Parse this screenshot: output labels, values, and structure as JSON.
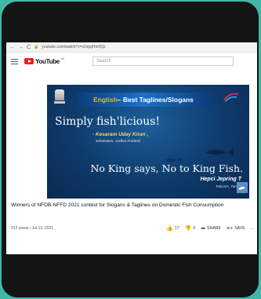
{
  "browser": {
    "back_glyph": "←",
    "forward_glyph": "→",
    "reload_glyph": "C",
    "url": "youtube.com/watch?v=x1xpqHofJQs"
  },
  "header": {
    "logo_text": "YouTube",
    "country": "IN",
    "search_placeholder": "Search"
  },
  "video": {
    "banner_lang": "English",
    "banner_rest": " – Best Taglines/Slogans",
    "slogan1": "Simply fish'licious!",
    "author1": "- Kesaram Uday Kiran ,",
    "place1": "Srikakulam, Andhra Pradesh",
    "slogan2": "No King says, No to King Fish.",
    "author2": "Hepci Jepring T",
    "place2": "Tuticorin, Tami"
  },
  "details": {
    "title": "Winners of NFDB-NFFD 2021 contest for Slogans & Taglines on Domestic Fish Consumption",
    "views": "313 views • Jul 13, 2021",
    "likes": "17",
    "dislikes": "0",
    "share": "SHARE",
    "save": "SAVE",
    "more": "..."
  },
  "colors": {
    "background": "#3fb8a8",
    "youtube_red": "#e62117",
    "banner_accent": "#ffb300"
  }
}
